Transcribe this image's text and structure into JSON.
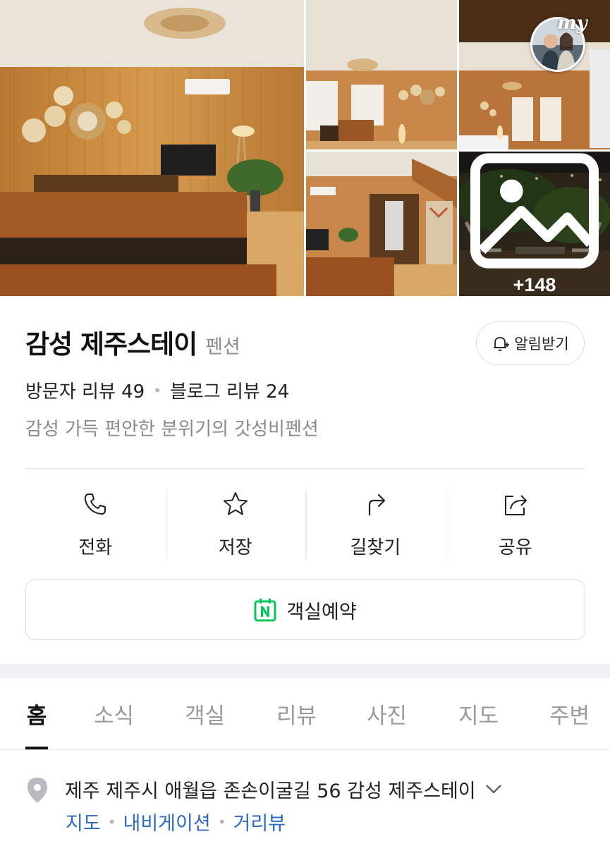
{
  "gallery": {
    "more_count": "+148",
    "more_icon": "image-icon",
    "badge_text": "my"
  },
  "place": {
    "name": "감성 제주스테이",
    "category": "펜션",
    "visitor_reviews": "방문자 리뷰 49",
    "blog_reviews": "블로그 리뷰 24",
    "description": "감성 가득 편안한 분위기의 갓성비펜션"
  },
  "notify": {
    "label": "알림받기",
    "icon": "bell-plus-icon"
  },
  "actions": [
    {
      "label": "전화",
      "icon": "phone-icon"
    },
    {
      "label": "저장",
      "icon": "star-icon"
    },
    {
      "label": "길찾기",
      "icon": "directions-icon"
    },
    {
      "label": "공유",
      "icon": "share-icon"
    }
  ],
  "reserve": {
    "label": "객실예약",
    "icon": "naver-calendar-icon",
    "accent": "#03c75a"
  },
  "tabs": [
    {
      "label": "홈",
      "active": true
    },
    {
      "label": "소식"
    },
    {
      "label": "객실"
    },
    {
      "label": "리뷰"
    },
    {
      "label": "사진"
    },
    {
      "label": "지도"
    },
    {
      "label": "주변"
    }
  ],
  "address": {
    "text": "제주 제주시 애월읍 존손이굴길 56 감성 제주스테이",
    "links": [
      "지도",
      "내비게이션",
      "거리뷰"
    ],
    "link_color": "#2d69c5"
  }
}
